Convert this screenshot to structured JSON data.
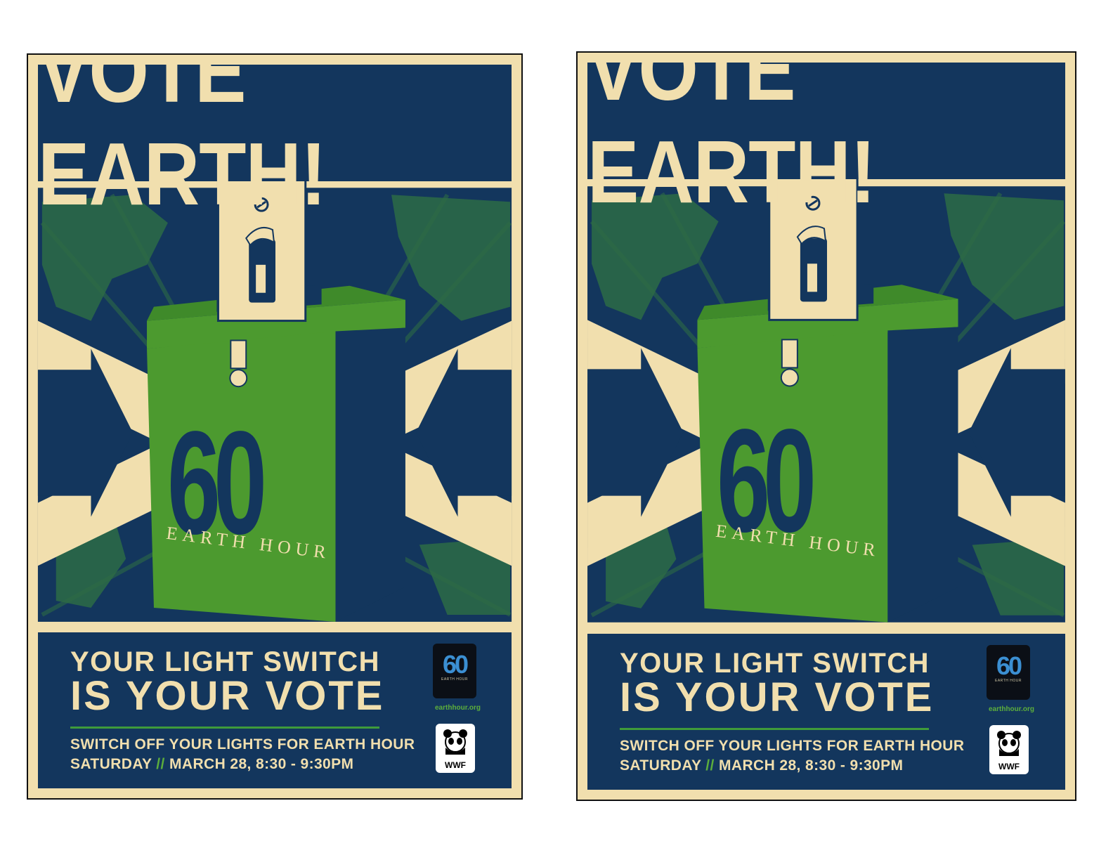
{
  "posters": [
    {
      "headline": "VOTE EARTH!",
      "box_number": "60",
      "box_label": "EARTH HOUR",
      "tagline_line1": "YOUR LIGHT SWITCH",
      "tagline_line2": "IS YOUR VOTE",
      "info_line1": "SWITCH OFF YOUR LIGHTS FOR EARTH HOUR",
      "info_day": "SATURDAY",
      "info_separator": "//",
      "info_datetime": "MARCH 28, 8:30 - 9:30PM",
      "logo_number": "60",
      "logo_text": "EARTH HOUR",
      "url": "earthhour.org",
      "wwf_label": "WWF"
    },
    {
      "headline": "VOTE EARTH!",
      "box_number": "60",
      "box_label": "EARTH HOUR",
      "tagline_line1": "YOUR LIGHT SWITCH",
      "tagline_line2": "IS YOUR VOTE",
      "info_line1": "SWITCH OFF YOUR LIGHTS FOR EARTH HOUR",
      "info_day": "SATURDAY",
      "info_separator": "//",
      "info_datetime": "MARCH 28, 8:30 - 9:30PM",
      "logo_number": "60",
      "logo_text": "EARTH HOUR",
      "url": "earthhour.org",
      "wwf_label": "WWF"
    }
  ],
  "colors": {
    "navy": "#13365d",
    "cream": "#f1dfae",
    "green": "#4c9a2f",
    "dark_green": "#2f6e24"
  }
}
